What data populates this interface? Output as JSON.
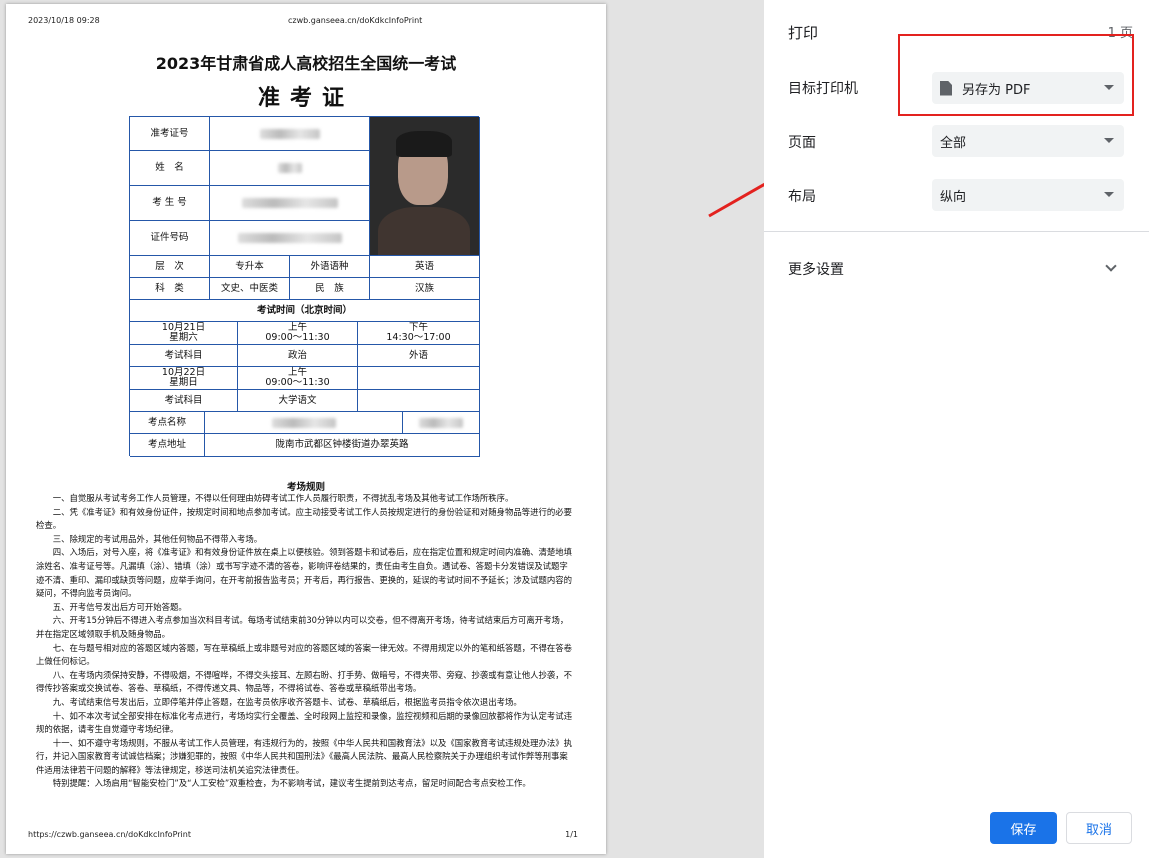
{
  "preview": {
    "header_date": "2023/10/18 09:28",
    "header_url": "czwb.ganseea.cn/doKdkcInfoPrint",
    "footer_url": "https://czwb.ganseea.cn/doKdkcInfoPrint",
    "footer_page": "1/1",
    "exam_title": "2023年甘肃省成人高校招生全国统一考试",
    "card_title": "准考证",
    "labels": {
      "ticket_no": "准考证号",
      "name": "姓　名",
      "candidate_no": "考 生 号",
      "id_no": "证件号码",
      "level": "层　次",
      "level_value": "专升本",
      "foreign_lang": "外语语种",
      "foreign_lang_value": "英语",
      "category": "科　类",
      "category_value": "文史、中医类",
      "ethnicity": "民　族",
      "ethnicity_value": "汉族",
      "exam_time": "考试时间（北京时间）",
      "day1_date": "10月21日",
      "day1_week": "星期六",
      "morning": "上午",
      "afternoon": "下午",
      "am_time": "09:00～11:30",
      "pm_time": "14:30～17:00",
      "subject": "考试科目",
      "day1_am_subject": "政治",
      "day1_pm_subject": "外语",
      "day2_date": "10月22日",
      "day2_week": "星期日",
      "day2_am_subject": "大学语文",
      "site_name": "考点名称",
      "site_address": "考点地址",
      "site_address_value": "陇南市武都区钟楼街道办翠英路"
    },
    "rules_title": "考场规则",
    "rules": [
      "一、自觉服从考试考务工作人员管理，不得以任何理由妨碍考试工作人员履行职责，不得扰乱考场及其他考试工作场所秩序。",
      "二、凭《准考证》和有效身份证件，按规定时间和地点参加考试。应主动接受考试工作人员按规定进行的身份验证和对随身物品等进行的必要检查。",
      "三、除规定的考试用品外，其他任何物品不得带入考场。",
      "四、入场后，对号入座，将《准考证》和有效身份证件放在桌上以便核验。领到答题卡和试卷后，应在指定位置和规定时间内准确、清楚地填涂姓名、准考证号等。凡漏填（涂）、错填（涂）或书写字迹不清的答卷，影响评卷结果的，责任由考生自负。遇试卷、答题卡分发错误及试题字迹不清、重印、漏印或缺页等问题，应举手询问，在开考前报告监考员；开考后，再行报告、更换的，延误的考试时间不予延长；涉及试题内容的疑问，不得向监考员询问。",
      "五、开考信号发出后方可开始答题。",
      "六、开考15分钟后不得进入考点参加当次科目考试。每场考试结束前30分钟以内可以交卷，但不得离开考场，待考试结束后方可离开考场，并在指定区域领取手机及随身物品。",
      "七、在与题号相对应的答题区域内答题，写在草稿纸上或非题号对应的答题区域的答案一律无效。不得用规定以外的笔和纸答题，不得在答卷上做任何标记。",
      "八、在考场内须保持安静，不得吸烟，不得喧哗，不得交头接耳、左顾右盼、打手势、做暗号，不得夹带、旁窥、抄袭或有意让他人抄袭，不得传抄答案或交换试卷、答卷、草稿纸，不得传递文具、物品等，不得将试卷、答卷或草稿纸带出考场。",
      "九、考试结束信号发出后，立即停笔并停止答题，在监考员依序收齐答题卡、试卷、草稿纸后，根据监考员指令依次退出考场。",
      "十、如不本次考试全部安排在标准化考点进行，考场均实行全覆盖、全时段网上监控和录像，监控视频和后期的录像回放都将作为认定考试违规的依据，请考生自觉遵守考场纪律。",
      "十一、如不遵守考场规则，不服从考试工作人员管理，有违规行为的，按照《中华人民共和国教育法》以及《国家教育考试违规处理办法》执行，并记入国家教育考试诚信档案；涉嫌犯罪的，按照《中华人民共和国刑法》《最高人民法院、最高人民检察院关于办理组织考试作弊等刑事案件适用法律若干问题的解释》等法律规定，移送司法机关追究法律责任。",
      "特别提醒：入场启用“智能安检门”及“人工安检”双重检查，为不影响考试，建议考生提前到达考点，留足时间配合考点安检工作。"
    ]
  },
  "settings": {
    "title": "打印",
    "page_count": "1 页",
    "destination_label": "目标打印机",
    "destination_value": "另存为 PDF",
    "pages_label": "页面",
    "pages_value": "全部",
    "layout_label": "布局",
    "layout_value": "纵向",
    "more_settings": "更多设置",
    "save_button": "保存",
    "cancel_button": "取消"
  },
  "colors": {
    "accent": "#1a73e8",
    "annotation": "#e3221f",
    "table_border": "#2557a8"
  },
  "icons": [
    "file-icon",
    "dropdown-caret-icon",
    "chevron-down-icon",
    "arrow-annotation-icon"
  ]
}
